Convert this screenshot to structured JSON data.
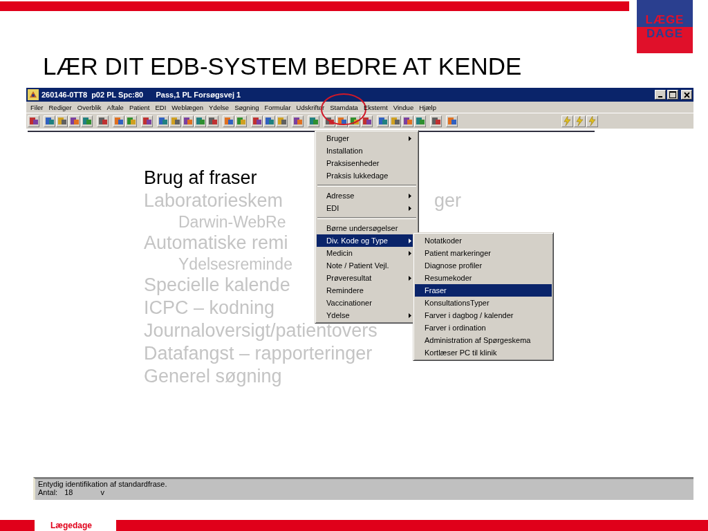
{
  "header": {
    "title": "LÆR DIT EDB-SYSTEM BEDRE AT KENDE"
  },
  "logo": {
    "lines": [
      "LÆGE",
      "DAGE"
    ]
  },
  "window": {
    "title": "260146-0TT8  p02 PL Spc:80      Pass,1 PL Forsøgsvej 1"
  },
  "menubar": [
    {
      "label": "Filer",
      "highlighted": false
    },
    {
      "label": "Rediger",
      "highlighted": false
    },
    {
      "label": "Overblik",
      "highlighted": false
    },
    {
      "label": "Aftale",
      "highlighted": false
    },
    {
      "label": "Patient",
      "highlighted": false
    },
    {
      "label": "EDI",
      "highlighted": false
    },
    {
      "label": "Weblægen",
      "highlighted": false
    },
    {
      "label": "Ydelse",
      "highlighted": false
    },
    {
      "label": "Søgning",
      "highlighted": false
    },
    {
      "label": "Formular",
      "highlighted": false
    },
    {
      "label": "Udskrifter",
      "highlighted": false
    },
    {
      "label": "Stamdata",
      "highlighted": true
    },
    {
      "label": "Eksternt",
      "highlighted": false
    },
    {
      "label": "Vindue",
      "highlighted": false
    },
    {
      "label": "Hjælp",
      "highlighted": false
    }
  ],
  "dropdown": [
    {
      "kind": "item",
      "label": "Bruger",
      "submenu": true,
      "selected": false
    },
    {
      "kind": "item",
      "label": "Installation",
      "submenu": false,
      "selected": false
    },
    {
      "kind": "item",
      "label": "Praksisenheder",
      "submenu": false,
      "selected": false
    },
    {
      "kind": "item",
      "label": "Praksis lukkedage",
      "submenu": false,
      "selected": false
    },
    {
      "kind": "separator"
    },
    {
      "kind": "item",
      "label": "Adresse",
      "submenu": true,
      "selected": false
    },
    {
      "kind": "item",
      "label": "EDI",
      "submenu": true,
      "selected": false
    },
    {
      "kind": "separator"
    },
    {
      "kind": "item",
      "label": "Børne undersøgelser",
      "submenu": false,
      "selected": false
    },
    {
      "kind": "item",
      "label": "Div. Kode og Type",
      "submenu": true,
      "selected": true
    },
    {
      "kind": "item",
      "label": "Medicin",
      "submenu": true,
      "selected": false
    },
    {
      "kind": "item",
      "label": "Note / Patient Vejl.",
      "submenu": false,
      "selected": false
    },
    {
      "kind": "item",
      "label": "Prøveresultat",
      "submenu": true,
      "selected": false
    },
    {
      "kind": "item",
      "label": "Remindere",
      "submenu": false,
      "selected": false
    },
    {
      "kind": "item",
      "label": "Vaccinationer",
      "submenu": false,
      "selected": false
    },
    {
      "kind": "item",
      "label": "Ydelse",
      "submenu": true,
      "selected": false
    }
  ],
  "submenu": [
    {
      "kind": "item",
      "label": "Notatkoder",
      "selected": false
    },
    {
      "kind": "item",
      "label": "Patient markeringer",
      "selected": false
    },
    {
      "kind": "item",
      "label": "Diagnose profiler",
      "selected": false
    },
    {
      "kind": "item",
      "label": "Resumekoder",
      "selected": false
    },
    {
      "kind": "item",
      "label": "Fraser",
      "selected": true
    },
    {
      "kind": "item",
      "label": "KonsultationsTyper",
      "selected": false
    },
    {
      "kind": "item",
      "label": "Farver i dagbog / kalender",
      "selected": false
    },
    {
      "kind": "item",
      "label": "Farver i ordination",
      "selected": false
    },
    {
      "kind": "item",
      "label": "Administration af Spørgeskema",
      "selected": false
    },
    {
      "kind": "item",
      "label": "Kortlæser PC til klinik",
      "selected": false
    }
  ],
  "bullets": [
    {
      "text": "Brug af fraser",
      "active": true
    },
    {
      "text": "Laboratorieskem",
      "tail": "ger",
      "active": false,
      "children": [
        {
          "text": "Darwin-WebRe",
          "active": false
        }
      ]
    },
    {
      "text": "Automatiske remi",
      "active": false,
      "children": [
        {
          "text": "Ydelsesreminde",
          "active": false
        }
      ]
    },
    {
      "text": "Specielle kalende",
      "active": false
    },
    {
      "text": "ICPC – kodning",
      "active": false
    },
    {
      "text": "Journaloversigt/patientovers",
      "active": false
    },
    {
      "text": "Datafangst – rapporteringer",
      "active": false
    },
    {
      "text": "Generel søgning",
      "active": false
    }
  ],
  "status_bar": {
    "message": "Entydig identifikation af standardfrase.",
    "count_label": "Antal:",
    "count": "18",
    "flag": "v"
  },
  "footer": {
    "text": "Lægedage"
  }
}
